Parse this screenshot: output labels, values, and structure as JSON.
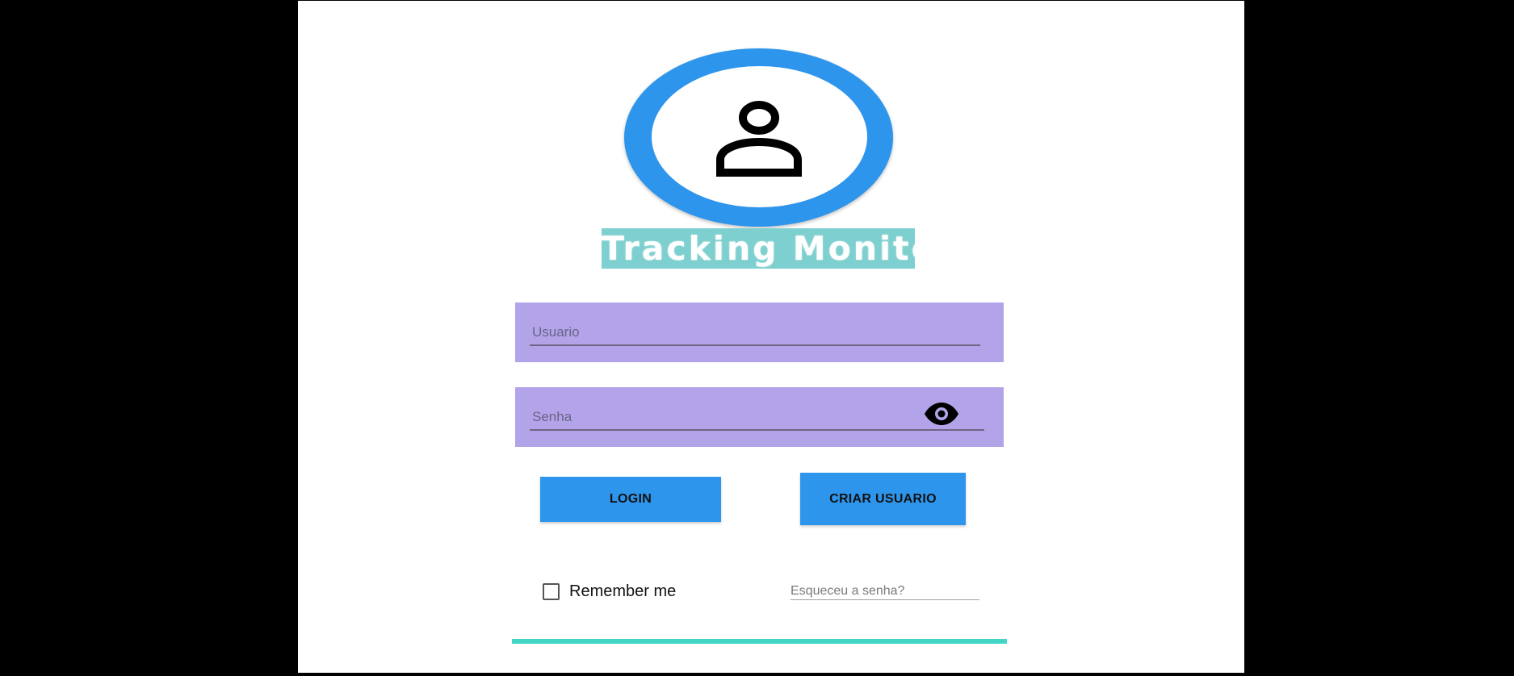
{
  "app": {
    "brand_title": "Tracking Monitor"
  },
  "avatar": {
    "icon": "user-icon"
  },
  "form": {
    "username_placeholder": "Usuario",
    "password_placeholder": "Senha",
    "password_toggle_icon": "eye-icon",
    "login_label": "LOGIN",
    "create_user_label": "CRIAR USUARIO",
    "remember_label": "Remember me",
    "remember_checked": false,
    "forgot_label": "Esqueceu a senha?"
  },
  "colors": {
    "primary_button": "#2e95ec",
    "field_background": "#b3a4e9",
    "brand_banner": "#7ecfcf",
    "accent_line": "#43d6c6"
  }
}
